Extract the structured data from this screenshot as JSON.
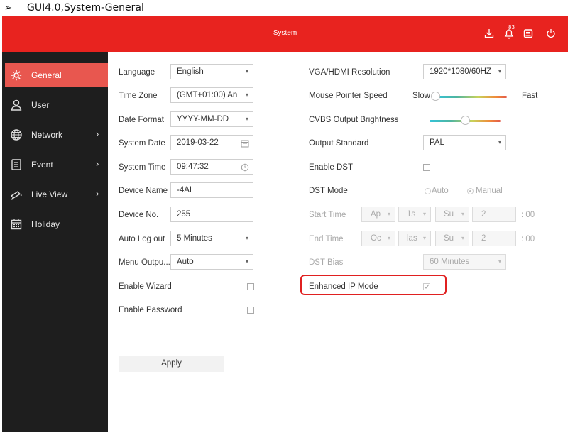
{
  "doc_heading": {
    "bullet": "➢",
    "text": "GUI4.0,System-General"
  },
  "topbar": {
    "title": "System",
    "alarm_count": "83"
  },
  "sidebar": {
    "items": [
      {
        "label": "General",
        "icon": "gear-icon",
        "active": true
      },
      {
        "label": "User",
        "icon": "user-icon"
      },
      {
        "label": "Network",
        "icon": "globe-icon",
        "chevron": "›"
      },
      {
        "label": "Event",
        "icon": "event-list-icon",
        "chevron": "›"
      },
      {
        "label": "Live View",
        "icon": "camera-icon",
        "chevron": "›"
      },
      {
        "label": "Holiday",
        "icon": "calendar-icon"
      }
    ]
  },
  "left": {
    "language": {
      "label": "Language",
      "value": "English"
    },
    "time_zone": {
      "label": "Time Zone",
      "value": "(GMT+01:00) An"
    },
    "date_format": {
      "label": "Date Format",
      "value": "YYYY-MM-DD"
    },
    "system_date": {
      "label": "System Date",
      "value": "2019-03-22"
    },
    "system_time": {
      "label": "System Time",
      "value": "09:47:32"
    },
    "device_name": {
      "label": "Device Name",
      "value": "-4AI"
    },
    "device_no": {
      "label": "Device No.",
      "value": "255"
    },
    "auto_logout": {
      "label": "Auto Log out",
      "value": "5 Minutes"
    },
    "menu_output": {
      "label": "Menu Outpu...",
      "value": "Auto"
    },
    "enable_wizard": {
      "label": "Enable Wizard",
      "checked": false
    },
    "enable_password": {
      "label": "Enable Password",
      "checked": false
    },
    "apply_label": "Apply"
  },
  "right": {
    "resolution": {
      "label": "VGA/HDMI Resolution",
      "value": "1920*1080/60HZ"
    },
    "mouse_speed": {
      "label": "Mouse Pointer Speed",
      "min_label": "Slow",
      "max_label": "Fast",
      "level": 0
    },
    "cvbs_brightness": {
      "label": "CVBS Output Brightness",
      "level": 0.5
    },
    "output_standard": {
      "label": "Output Standard",
      "value": "PAL"
    },
    "enable_dst": {
      "label": "Enable DST",
      "checked": false
    },
    "dst_mode": {
      "label": "DST Mode",
      "auto_label": "Auto",
      "manual_label": "Manual",
      "selected": "Manual"
    },
    "start_time": {
      "label": "Start Time",
      "month": "Ap",
      "week": "1s",
      "day": "Su",
      "hour": "2",
      "minutes": ": 00"
    },
    "end_time": {
      "label": "End Time",
      "month": "Oc",
      "week": "las",
      "day": "Su",
      "hour": "2",
      "minutes": ": 00"
    },
    "dst_bias": {
      "label": "DST Bias",
      "value": "60 Minutes"
    },
    "enhanced_ip": {
      "label": "Enhanced IP Mode",
      "checked": true
    }
  },
  "colors": {
    "brand": "#e8231f",
    "sidebar": "#1e1e1e",
    "active": "#e8574f",
    "highlight": "#e02020"
  }
}
